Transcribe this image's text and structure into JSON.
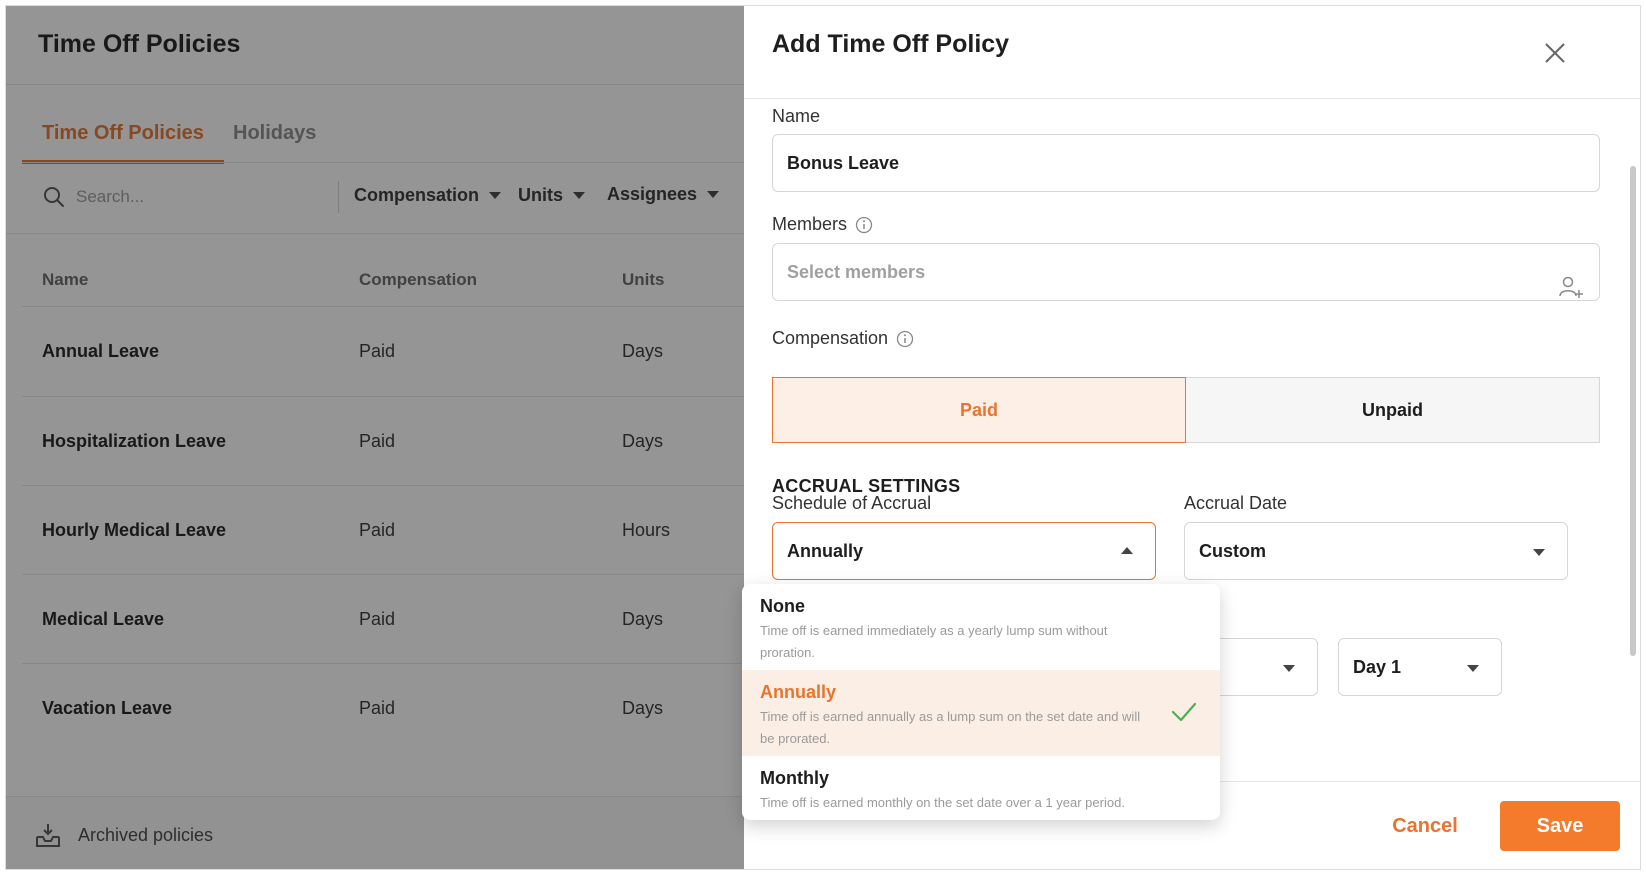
{
  "page": {
    "title": "Time Off Policies",
    "tabs": [
      {
        "label": "Time Off Policies",
        "active": true
      },
      {
        "label": "Holidays",
        "active": false
      }
    ],
    "search": {
      "placeholder": "Search..."
    },
    "filters": [
      "Compensation",
      "Units",
      "Assignees"
    ],
    "table": {
      "headers": [
        "Name",
        "Compensation",
        "Units"
      ],
      "rows": [
        {
          "name": "Annual Leave",
          "compensation": "Paid",
          "units": "Days"
        },
        {
          "name": "Hospitalization Leave",
          "compensation": "Paid",
          "units": "Days"
        },
        {
          "name": "Hourly Medical Leave",
          "compensation": "Paid",
          "units": "Hours"
        },
        {
          "name": "Medical Leave",
          "compensation": "Paid",
          "units": "Days"
        },
        {
          "name": "Vacation Leave",
          "compensation": "Paid",
          "units": "Days"
        }
      ]
    },
    "archived_label": "Archived policies"
  },
  "drawer": {
    "title": "Add Time Off Policy",
    "name_label": "Name",
    "name_value": "Bonus Leave",
    "members_label": "Members",
    "members_placeholder": "Select members",
    "compensation_label": "Compensation",
    "compensation_options": [
      "Paid",
      "Unpaid"
    ],
    "compensation_selected": "Paid",
    "section_title": "ACCRUAL SETTINGS",
    "schedule_label": "Schedule of Accrual",
    "schedule_value": "Annually",
    "accrual_date_label": "Accrual Date",
    "accrual_date_value": "Custom",
    "day_value": "Day 1",
    "cancel_label": "Cancel",
    "save_label": "Save",
    "schedule_menu": [
      {
        "title": "None",
        "desc": "Time off is earned immediately as a yearly lump sum without proration.",
        "selected": false
      },
      {
        "title": "Annually",
        "desc": "Time off is earned annually as a lump sum on the set date and will be prorated.",
        "selected": true
      },
      {
        "title": "Monthly",
        "desc": "Time off is earned monthly on the set date over a 1 year period.",
        "selected": false
      }
    ]
  },
  "colors": {
    "accent": "#e8742f",
    "save_button": "#f47a2c",
    "selected_bg": "#fbeee5"
  },
  "icons": [
    "search-icon",
    "info-icon",
    "add-member-icon",
    "close-icon",
    "check-icon",
    "archive-inbox-icon"
  ]
}
